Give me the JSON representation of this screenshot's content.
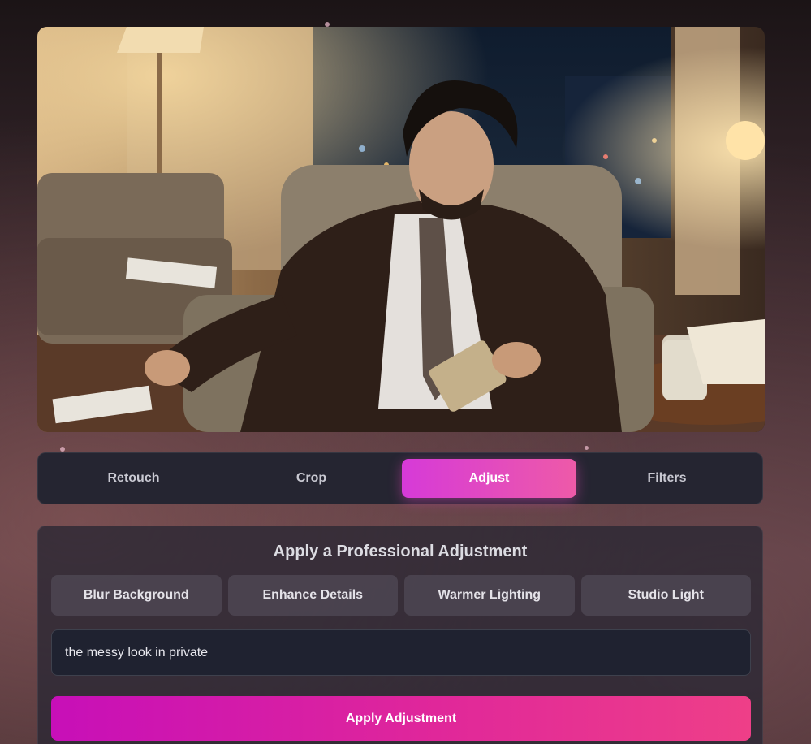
{
  "photo": {
    "description_icon": "image-preview"
  },
  "tabs": [
    {
      "label": "Retouch",
      "active": false
    },
    {
      "label": "Crop",
      "active": false
    },
    {
      "label": "Adjust",
      "active": true
    },
    {
      "label": "Filters",
      "active": false
    }
  ],
  "adjust_panel": {
    "title": "Apply a Professional Adjustment",
    "presets": [
      {
        "label": "Blur Background"
      },
      {
        "label": "Enhance Details"
      },
      {
        "label": "Warmer Lighting"
      },
      {
        "label": "Studio Light"
      }
    ],
    "prompt_value": "the messy look in private",
    "apply_label": "Apply Adjustment"
  },
  "colors": {
    "accent_start": "#d63ad8",
    "accent_end": "#ee5aa8",
    "apply_start": "#c70fb8",
    "apply_end": "#ee3f88"
  }
}
